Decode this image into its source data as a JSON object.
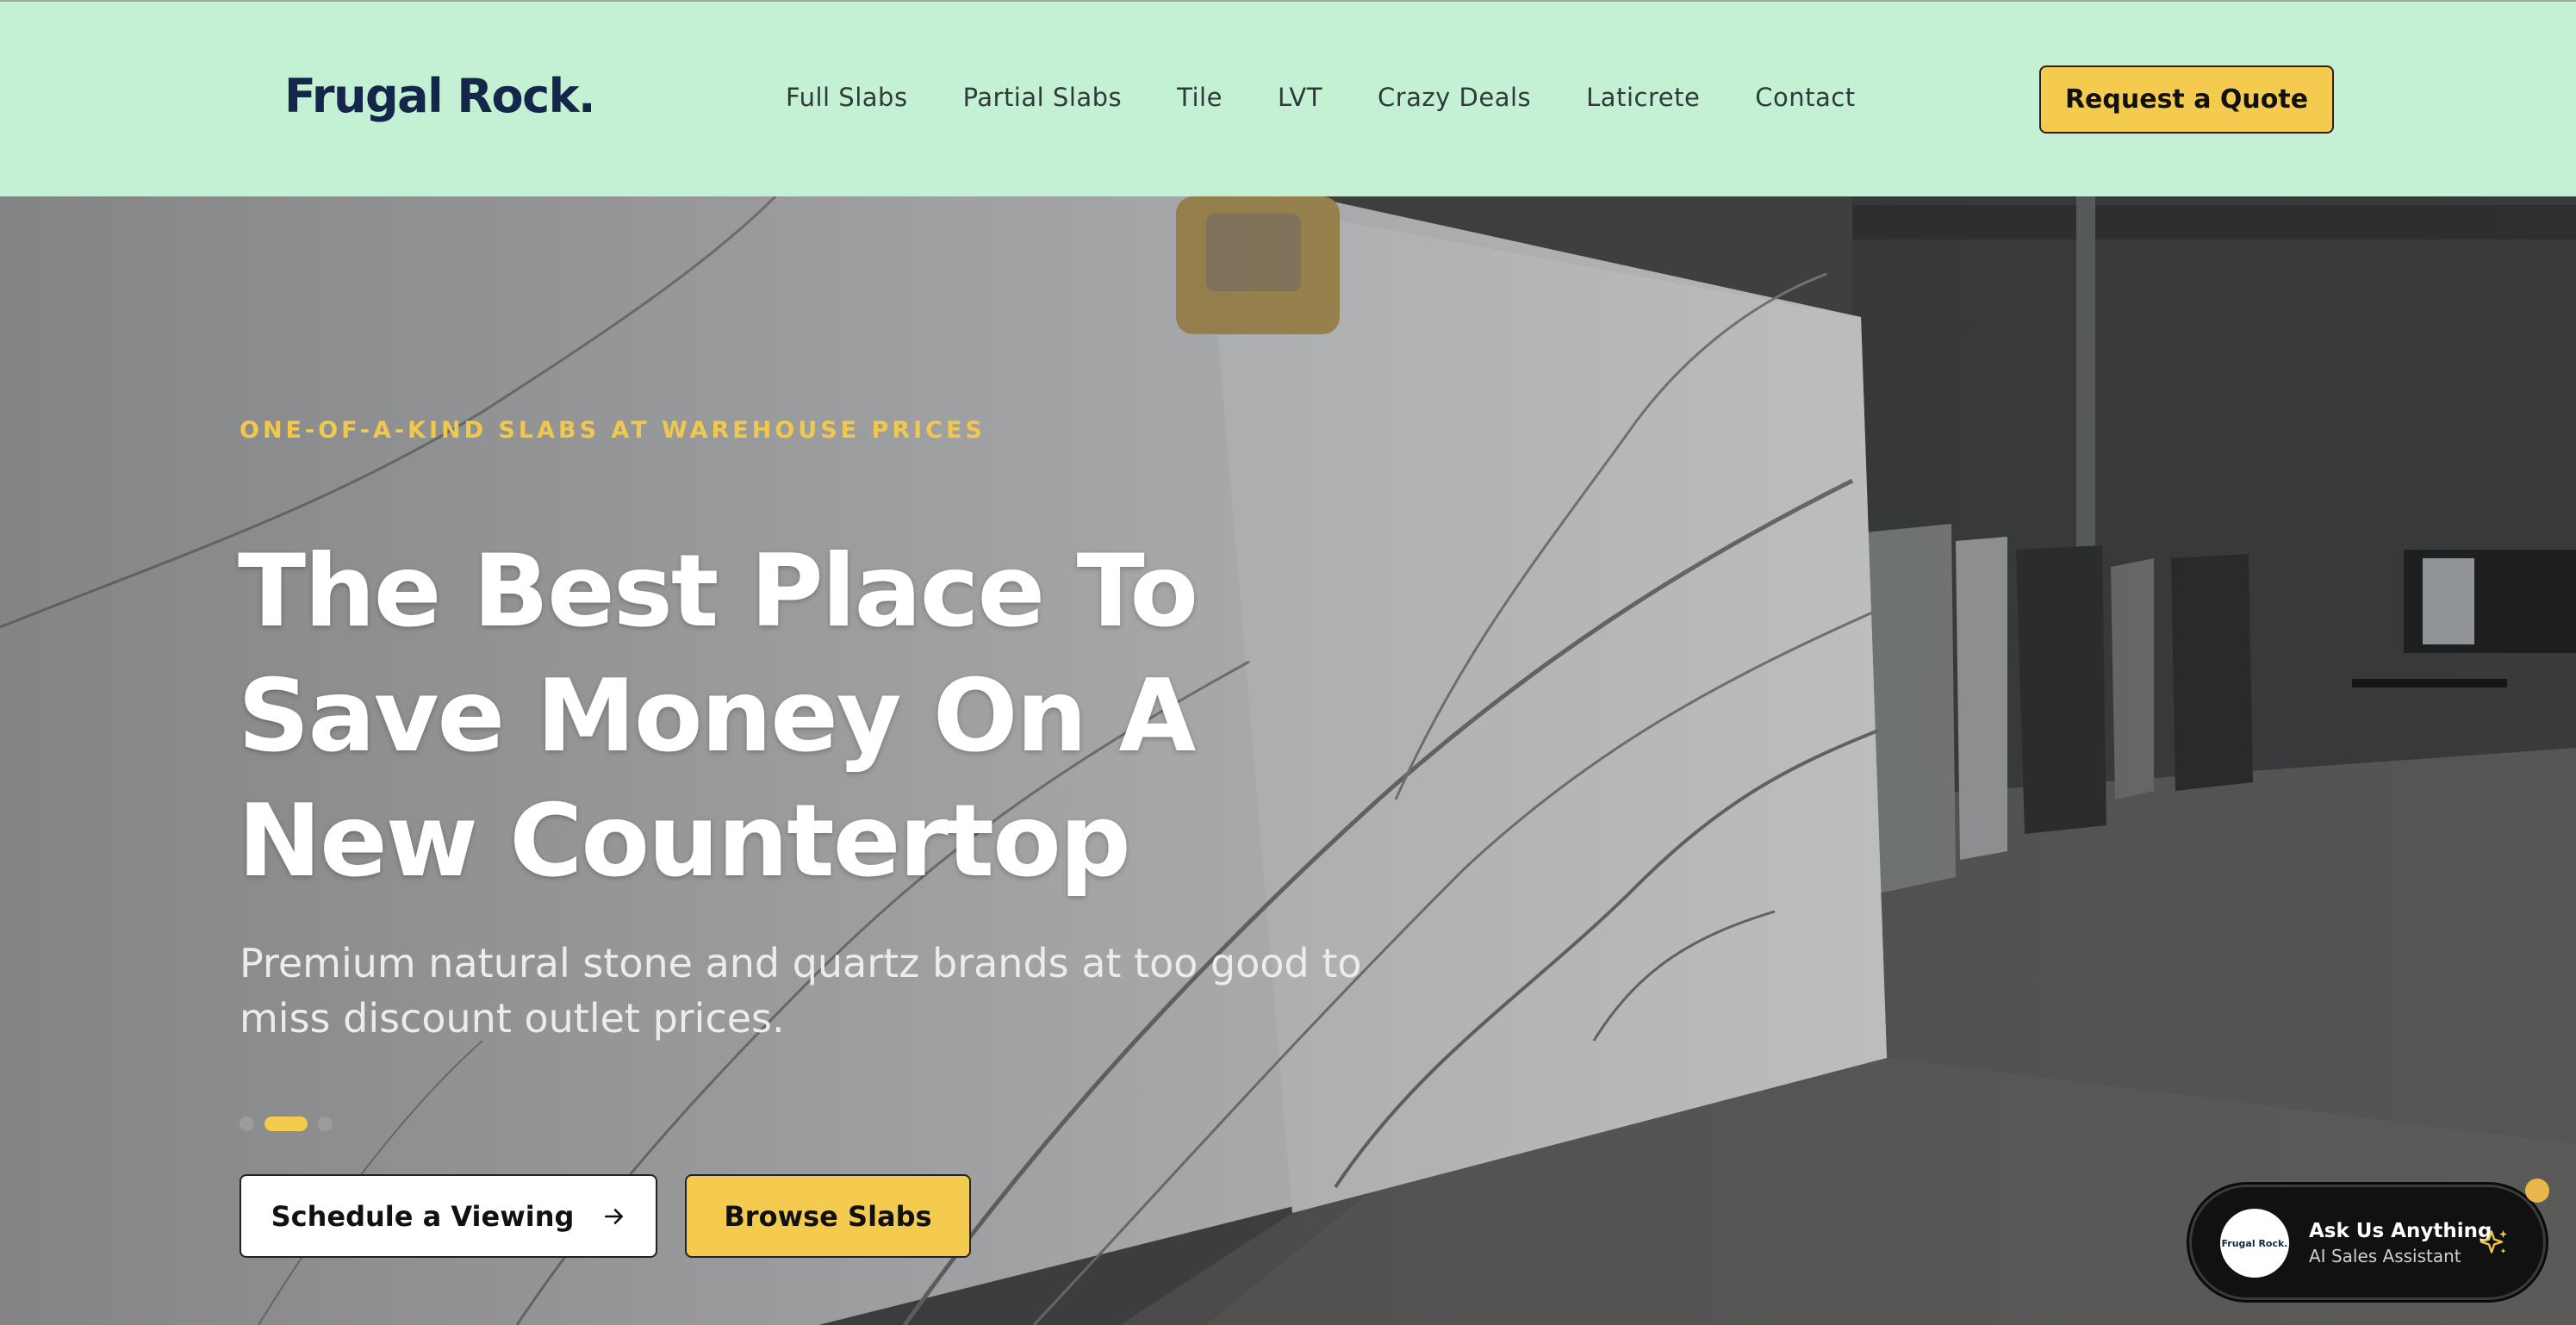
{
  "header": {
    "logo": "Frugal Rock.",
    "nav": [
      {
        "label": "Full Slabs"
      },
      {
        "label": "Partial Slabs"
      },
      {
        "label": "Tile"
      },
      {
        "label": "LVT"
      },
      {
        "label": "Crazy Deals"
      },
      {
        "label": "Laticrete"
      },
      {
        "label": "Contact"
      }
    ],
    "cta_label": "Request a Quote"
  },
  "hero": {
    "eyebrow": "ONE-OF-A-KIND SLABS AT WAREHOUSE PRICES",
    "headline": "The Best Place To Save Money On A New Countertop",
    "subhead": "Premium natural stone and quartz brands at too good to miss discount outlet prices.",
    "carousel": {
      "slides": 3,
      "active_slide": 2
    },
    "primary_button": "Schedule a Viewing",
    "secondary_button": "Browse Slabs"
  },
  "chat_widget": {
    "avatar_text": "Frugal Rock.",
    "title": "Ask Us Anything",
    "subtitle": "AI Sales Assistant",
    "icon": "sparkle-icon"
  },
  "colors": {
    "header_bg": "#c4f0d3",
    "accent_yellow": "#f5cb4f",
    "logo_navy": "#14264a",
    "eyebrow_gold": "#f1c84e"
  }
}
